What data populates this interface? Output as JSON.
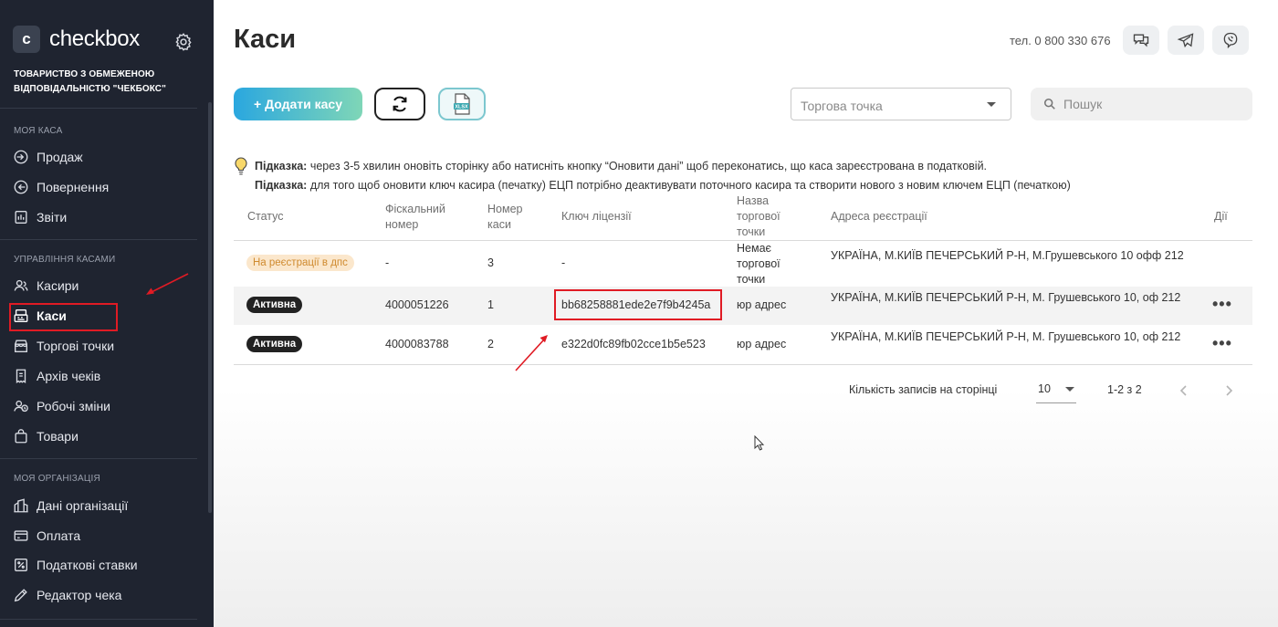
{
  "app": {
    "logo_letter": "c",
    "logo_text": "checkbox"
  },
  "org": {
    "name": "ТОВАРИСТВО З ОБМЕЖЕНОЮ ВІДПОВІДАЛЬНІСТЮ \"ЧЕКБОКС\""
  },
  "sidebar": {
    "section1": "МОЯ КАСА",
    "section2": "УПРАВЛІННЯ КАСАМИ",
    "section3": "МОЯ ОРГАНІЗАЦІЯ",
    "items": [
      {
        "label": "Продаж",
        "icon": "sale-icon"
      },
      {
        "label": "Повернення",
        "icon": "return-icon"
      },
      {
        "label": "Звіти",
        "icon": "report-icon"
      },
      {
        "label": "Касири",
        "icon": "cashiers-icon"
      },
      {
        "label": "Каси",
        "icon": "cash-register-icon"
      },
      {
        "label": "Торгові точки",
        "icon": "store-icon"
      },
      {
        "label": "Архів чеків",
        "icon": "archive-icon"
      },
      {
        "label": "Робочі зміни",
        "icon": "shifts-icon"
      },
      {
        "label": "Товари",
        "icon": "goods-icon"
      },
      {
        "label": "Дані організації",
        "icon": "org-data-icon"
      },
      {
        "label": "Оплата",
        "icon": "payment-icon"
      },
      {
        "label": "Податкові ставки",
        "icon": "tax-icon"
      },
      {
        "label": "Редактор чека",
        "icon": "receipt-editor-icon"
      }
    ],
    "active": "Каси"
  },
  "header": {
    "title": "Каси",
    "phone": "тел. 0 800 330 676"
  },
  "toolbar": {
    "add_label": "+ Додати касу",
    "xlsx_label": "XLSX",
    "store_placeholder": "Торгова точка",
    "search_placeholder": "Пошук"
  },
  "hints": [
    {
      "bold": "Підказка:",
      "text": " через 3-5 хвилин оновіть сторінку або натисніть кнопку “Оновити дані” щоб переконатись, що каса зареєстрована в податковій."
    },
    {
      "bold": "Підказка:",
      "text": " для того щоб оновити ключ касира (печатку) ЕЦП потрібно деактивувати поточного касира та створити нового з новим ключем ЕЦП (печаткою)"
    }
  ],
  "table": {
    "columns": {
      "status": "Статус",
      "fiscal": "Фіскальний номер",
      "number": "Номер каси",
      "license": "Ключ ліцензії",
      "store": "Назва торгової точки",
      "address": "Адреса реєстрації",
      "actions": "Дії"
    },
    "rows": [
      {
        "status": "На реєстрації в дпс",
        "fiscal": "-",
        "number": "3",
        "license": "-",
        "store": "Немає торгової точки",
        "address": "УКРАЇНА, М.КИЇВ ПЕЧЕРСЬКИЙ Р-Н, М.Грушевського 10 офф 212",
        "actions": ""
      },
      {
        "status": "Активна",
        "fiscal": "4000051226",
        "number": "1",
        "license": "bb68258881ede2e7f9b4245a",
        "store": "юр адрес",
        "address": "УКРАЇНА, М.КИЇВ ПЕЧЕРСЬКИЙ Р-Н, М. Грушевського 10, оф 212",
        "actions": "•••"
      },
      {
        "status": "Активна",
        "fiscal": "4000083788",
        "number": "2",
        "license": "e322d0fc89fb02cce1b5e523",
        "store": "юр адрес",
        "address": "УКРАЇНА, М.КИЇВ ПЕЧЕРСЬКИЙ Р-Н, М. Грушевського 10, оф 212",
        "actions": "•••"
      }
    ]
  },
  "pagination": {
    "per_page_label": "Кількість записів на сторінці",
    "per_page": "10",
    "range": "1-2 з 2"
  },
  "colors": {
    "sidebar_bg": "#1f2430",
    "accent_start": "#2aa7df",
    "accent_end": "#7fd6b7",
    "highlight": "#e01b24",
    "badge_pending_bg": "#fbe7cc",
    "badge_active_bg": "#222222"
  }
}
